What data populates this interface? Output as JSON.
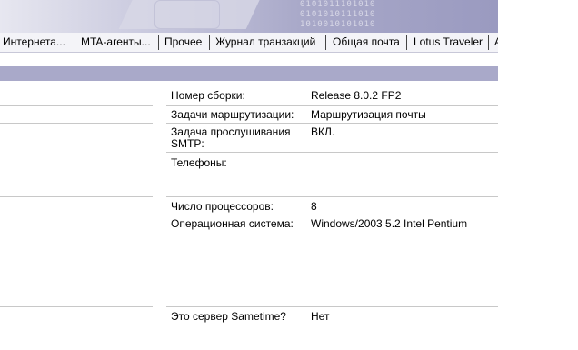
{
  "banner": {
    "binary_lines": [
      "0101011101010",
      "0101010111010",
      "1010010101010"
    ]
  },
  "tabs": [
    {
      "label": "Интернета..."
    },
    {
      "label": "MTA-агенты..."
    },
    {
      "label": "Прочее"
    },
    {
      "label": "Журнал транзакций"
    },
    {
      "label": "Общая почта"
    },
    {
      "label": "Lotus Traveler"
    },
    {
      "label": "A"
    }
  ],
  "fields": {
    "build": {
      "label": "Номер сборки:",
      "value": "Release 8.0.2 FP2"
    },
    "routing": {
      "label": "Задачи маршрутизации:",
      "value": "Маршрутизация почты"
    },
    "smtp": {
      "label_line1": "Задача прослушивания",
      "label_line2": "SMTP:",
      "value": "ВКЛ."
    },
    "phones": {
      "label": "Телефоны:",
      "value": ""
    },
    "cpus": {
      "label": "Число процессоров:",
      "value": "8"
    },
    "os": {
      "label": "Операционная система:",
      "value": "Windows/2003 5.2 Intel Pentium"
    },
    "sametime": {
      "label": "Это сервер Sametime?",
      "value": "Нет"
    }
  }
}
